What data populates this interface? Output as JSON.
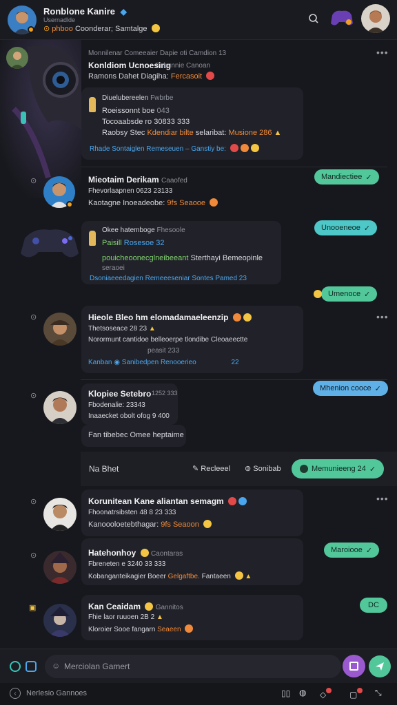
{
  "header": {
    "title": "Ronblone Kanire",
    "handle": "Usernadlde",
    "status": "phboo",
    "subtitle": "Coonderar; Samtalge"
  },
  "messages": [
    {
      "header": "Monnilenar Comeeaier Dapie oti Camdion  13",
      "name": "Konldiom Ucnoesing",
      "sub": "Subunnie Canoan",
      "line1": "Ramons Dahet Diagiha:",
      "line1_accent": "Fercasoit",
      "embed": {
        "title": "Diuelubereelen",
        "title_meta": "Fwbrbe",
        "line1": "Roeissonnt boe",
        "line1_val": "043",
        "line2": "Tocoaabsde ro 30833 333",
        "line3": "Raobsy Stec",
        "line3_accent": "Kdendiar bilte",
        "line3_rest": "selaribat:",
        "line3_num": "Musione 286",
        "link": "Rhade Sontaiglen  Remeseuen",
        "link_tail": "Ganstiy be:"
      }
    },
    {
      "name": "Mieotaim Derikam",
      "meta": "Caaofed",
      "line1": "Fhevorlaapnen 0623 23133",
      "line2": "Kaotagne Inoeadeobe:",
      "line2_accent": "9fs Seaooe",
      "embed": {
        "title": "Okee hatemboge",
        "title_meta": "Fhesoole",
        "green": "Paisill",
        "green_rest": "Rosesoe 32",
        "line2": "pouicheoonecglneibeeant",
        "line2_rest": "Sterthayi Bemeopinle",
        "line3": "seraoei",
        "link": "Dsoniaeeedagien Remeeeseniar Sontes Pamed 23"
      }
    },
    {
      "name": "Hieole Bleo hm elomadamaeleenzip",
      "line1": "Thetsoseace 28 23",
      "line2": "Norormunt cantidoe belleoerpe tlondibe Cleoaeectte",
      "line3": "peasit 233",
      "link": "Kanban",
      "link2": "Sanibedpen Renooerieo",
      "num": "22"
    },
    {
      "name": "Klopiee Setebro",
      "meta": "1252  333",
      "line1": "Fbodenalie: 23343",
      "line2": "Inaaecket obolt ofog 9 400",
      "extra": "Fan tibebec Omee heptaime"
    },
    {
      "name": "Korunitean Kane aliantan semagm",
      "line1": "Fhoonatrsibsten 48 8 23 333",
      "line2": "Kanoooloetebthagar:",
      "line2_accent": "9fs Seaoon"
    },
    {
      "name": "Hatehonhoy",
      "meta": "Caontaras",
      "line1": "Fbreneten e 3240 33 333",
      "line2": "Kobanganteikagier Boeer",
      "line2_accent": "Gelgaftbe.",
      "line2_rest": "Fantaeen"
    },
    {
      "name": "Kan Ceaidam",
      "meta": "Gannitos",
      "line1": "Fhie laor ruuoen 2B 2",
      "line2": "Kloroier Sooe fangarn",
      "line2_accent": "Seaeen"
    }
  ],
  "pills": [
    "Mandiectiee",
    "Unooeneoe",
    "Umenoce",
    "Mhenion cooce",
    "Maroiooe",
    "DC"
  ],
  "action_bar": {
    "label": "Na Bhet",
    "reload": "Recleeel",
    "settings": "Sonibab",
    "main": "Memunieeng 24"
  },
  "composer": {
    "placeholder": "Merciolan Gamert"
  },
  "footer": {
    "label": "Nerlesio Gannoes"
  },
  "colors": {
    "accent_green": "#52c79a",
    "accent_purple": "#9b59d0",
    "background": "#17181d",
    "card": "#212229"
  },
  "icons": [
    "search-icon",
    "verified-icon",
    "more-icon",
    "check-icon",
    "send-icon",
    "attach-icon",
    "emoji-icon",
    "edit-icon",
    "back-icon"
  ]
}
